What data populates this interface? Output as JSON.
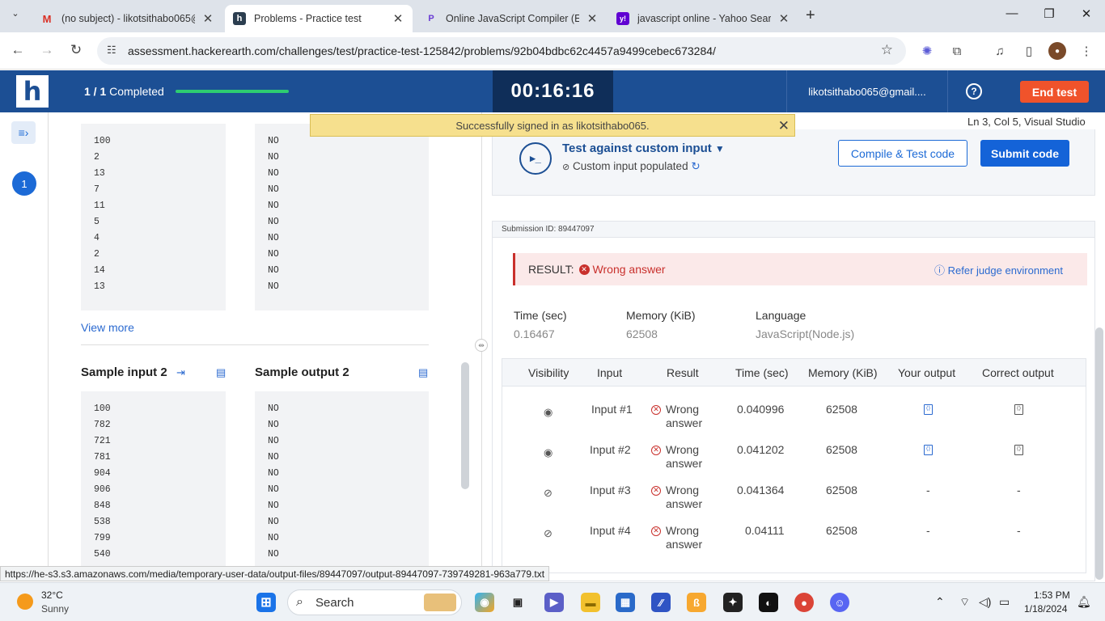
{
  "browser": {
    "tabs": [
      {
        "title": "(no subject) - likotsithabo065@",
        "active": false,
        "icon": "gmail-icon"
      },
      {
        "title": "Problems - Practice test",
        "active": true,
        "icon": "hackerearth-icon"
      },
      {
        "title": "Online JavaScript Compiler (Edi",
        "active": false,
        "icon": "programiz-icon"
      },
      {
        "title": "javascript online - Yahoo Search",
        "active": false,
        "icon": "yahoo-icon"
      }
    ],
    "url": "assessment.hackerearth.com/challenges/test/practice-test-125842/problems/92b04bdbc62c4457a9499cebec673284/",
    "status_url": "https://he-s3.s3.amazonaws.com/media/temporary-user-data/output-files/89447097/output-89447097-739749281-963a779.txt"
  },
  "header": {
    "logo": "h",
    "progress_bold": "1 / 1",
    "progress_rest": " Completed",
    "timer": "00:16:16",
    "email": "likotsithabo065@gmail....",
    "end_test": "End test"
  },
  "rail": {
    "question_number": "1"
  },
  "sample1": {
    "input": [
      "100",
      "2",
      "13",
      "7",
      "11",
      "5",
      "4",
      "2",
      "14",
      "13"
    ],
    "output": [
      "NO",
      "NO",
      "NO",
      "NO",
      "NO",
      "NO",
      "NO",
      "NO",
      "NO",
      "NO"
    ],
    "view_more": "View more"
  },
  "sample2": {
    "input_title": "Sample input 2",
    "output_title": "Sample output 2",
    "input": [
      "100",
      "782",
      "721",
      "781",
      "904",
      "906",
      "848",
      "538",
      "799",
      "540"
    ],
    "output": [
      "NO",
      "NO",
      "NO",
      "NO",
      "NO",
      "NO",
      "NO",
      "NO",
      "NO",
      "NO"
    ]
  },
  "toast": {
    "message": "Successfully signed in as likotsithabo065."
  },
  "editor_status": "Ln 3, Col 5, Visual Studio",
  "custom": {
    "title": "Test against custom input",
    "subtitle": "Custom input populated",
    "compile_label": "Compile & Test code",
    "submit_label": "Submit code"
  },
  "submission": {
    "id_label": "Submission ID: 89447097",
    "result_label": "RESULT:",
    "result_value": "Wrong answer",
    "refer_label": "Refer judge environment",
    "stats": {
      "time_label": "Time (sec)",
      "time_value": "0.16467",
      "memory_label": "Memory (KiB)",
      "memory_value": "62508",
      "language_label": "Language",
      "language_value": "JavaScript(Node.js)"
    },
    "table": {
      "headers": [
        "Visibility",
        "Input",
        "Result",
        "Time (sec)",
        "Memory (KiB)",
        "Your output",
        "Correct output"
      ],
      "rows": [
        {
          "visible": true,
          "input": "Input #1",
          "result_line1": "Wrong",
          "result_line2": "answer",
          "time": "0.040996",
          "memory": "62508",
          "your_output": "",
          "correct_output": ""
        },
        {
          "visible": true,
          "input": "Input #2",
          "result_line1": "Wrong",
          "result_line2": "answer",
          "time": "0.041202",
          "memory": "62508",
          "your_output": "",
          "correct_output": ""
        },
        {
          "visible": false,
          "input": "Input #3",
          "result_line1": "Wrong",
          "result_line2": "answer",
          "time": "0.041364",
          "memory": "62508",
          "your_output": "-",
          "correct_output": "-"
        },
        {
          "visible": false,
          "input": "Input #4",
          "result_line1": "Wrong",
          "result_line2": "answer",
          "time": "0.04111",
          "memory": "62508",
          "your_output": "-",
          "correct_output": "-"
        }
      ]
    }
  },
  "taskbar": {
    "temperature": "32°C",
    "weather": "Sunny",
    "search_label": "Search",
    "time": "1:53 PM",
    "date": "1/18/2024"
  }
}
